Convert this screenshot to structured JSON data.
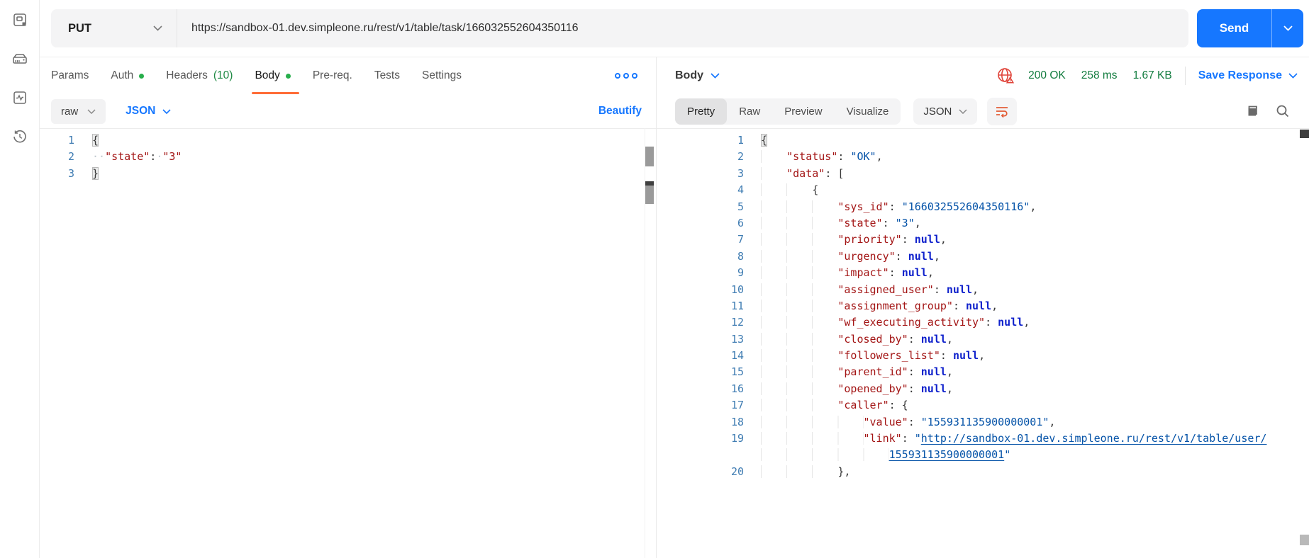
{
  "colors": {
    "accent_blue": "#1677ff",
    "tab_underline_orange": "#ff6c37",
    "status_green": "#127c3f",
    "dot_green": "#27ae4b",
    "json_key_maroon": "#a31515",
    "json_value_blue": "#0553a8",
    "json_null_blue": "#1022cc",
    "error_red": "#e0443a"
  },
  "sidebar": {
    "icons": [
      "collections",
      "server",
      "activity",
      "history"
    ]
  },
  "request_bar": {
    "method": "PUT",
    "url": "https://sandbox-01.dev.simpleone.ru/rest/v1/table/task/166032552604350116",
    "send_label": "Send"
  },
  "request_tabs": {
    "items": [
      {
        "label": "Params"
      },
      {
        "label": "Auth",
        "dot": true
      },
      {
        "label": "Headers",
        "count": "(10)"
      },
      {
        "label": "Body",
        "dot": true,
        "active": true
      },
      {
        "label": "Pre-req."
      },
      {
        "label": "Tests"
      },
      {
        "label": "Settings"
      }
    ]
  },
  "request_toolbar": {
    "body_type": "raw",
    "language": "JSON",
    "beautify_label": "Beautify"
  },
  "request_editor": {
    "lines": [
      {
        "n": "1",
        "tokens": [
          {
            "t": "brkt",
            "v": "{"
          }
        ]
      },
      {
        "n": "2",
        "tokens": [
          {
            "t": "wsd",
            "v": "··"
          },
          {
            "t": "str",
            "v": "\"state\""
          },
          {
            "t": "punc",
            "v": ":"
          },
          {
            "t": "wsd",
            "v": "·"
          },
          {
            "t": "str",
            "v": "\"3\""
          }
        ]
      },
      {
        "n": "3",
        "tokens": [
          {
            "t": "brkt",
            "v": "}"
          }
        ]
      }
    ]
  },
  "response_header": {
    "title": "Body",
    "status": "200 OK",
    "time": "258 ms",
    "size": "1.67 KB",
    "save_label": "Save Response"
  },
  "response_toolbar": {
    "view_tabs": [
      "Pretty",
      "Raw",
      "Preview",
      "Visualize"
    ],
    "active_view": "Pretty",
    "language": "JSON"
  },
  "response_editor": {
    "lines": [
      {
        "n": "1",
        "tokens": [
          {
            "t": "brkt",
            "v": "{"
          }
        ]
      },
      {
        "n": "2",
        "tokens": [
          {
            "t": "ws",
            "v": "    "
          },
          {
            "t": "key",
            "v": "\"status\""
          },
          {
            "t": "punc",
            "v": ": "
          },
          {
            "t": "val",
            "v": "\"OK\""
          },
          {
            "t": "punc",
            "v": ","
          }
        ]
      },
      {
        "n": "3",
        "tokens": [
          {
            "t": "ws",
            "v": "    "
          },
          {
            "t": "key",
            "v": "\"data\""
          },
          {
            "t": "punc",
            "v": ": ["
          }
        ]
      },
      {
        "n": "4",
        "tokens": [
          {
            "t": "ws",
            "v": "        "
          },
          {
            "t": "punc",
            "v": "{"
          }
        ]
      },
      {
        "n": "5",
        "tokens": [
          {
            "t": "ws",
            "v": "            "
          },
          {
            "t": "key",
            "v": "\"sys_id\""
          },
          {
            "t": "punc",
            "v": ": "
          },
          {
            "t": "val",
            "v": "\"166032552604350116\""
          },
          {
            "t": "punc",
            "v": ","
          }
        ]
      },
      {
        "n": "6",
        "tokens": [
          {
            "t": "ws",
            "v": "            "
          },
          {
            "t": "key",
            "v": "\"state\""
          },
          {
            "t": "punc",
            "v": ": "
          },
          {
            "t": "val",
            "v": "\"3\""
          },
          {
            "t": "punc",
            "v": ","
          }
        ]
      },
      {
        "n": "7",
        "tokens": [
          {
            "t": "ws",
            "v": "            "
          },
          {
            "t": "key",
            "v": "\"priority\""
          },
          {
            "t": "punc",
            "v": ": "
          },
          {
            "t": "kw",
            "v": "null"
          },
          {
            "t": "punc",
            "v": ","
          }
        ]
      },
      {
        "n": "8",
        "tokens": [
          {
            "t": "ws",
            "v": "            "
          },
          {
            "t": "key",
            "v": "\"urgency\""
          },
          {
            "t": "punc",
            "v": ": "
          },
          {
            "t": "kw",
            "v": "null"
          },
          {
            "t": "punc",
            "v": ","
          }
        ]
      },
      {
        "n": "9",
        "tokens": [
          {
            "t": "ws",
            "v": "            "
          },
          {
            "t": "key",
            "v": "\"impact\""
          },
          {
            "t": "punc",
            "v": ": "
          },
          {
            "t": "kw",
            "v": "null"
          },
          {
            "t": "punc",
            "v": ","
          }
        ]
      },
      {
        "n": "10",
        "tokens": [
          {
            "t": "ws",
            "v": "            "
          },
          {
            "t": "key",
            "v": "\"assigned_user\""
          },
          {
            "t": "punc",
            "v": ": "
          },
          {
            "t": "kw",
            "v": "null"
          },
          {
            "t": "punc",
            "v": ","
          }
        ]
      },
      {
        "n": "11",
        "tokens": [
          {
            "t": "ws",
            "v": "            "
          },
          {
            "t": "key",
            "v": "\"assignment_group\""
          },
          {
            "t": "punc",
            "v": ": "
          },
          {
            "t": "kw",
            "v": "null"
          },
          {
            "t": "punc",
            "v": ","
          }
        ]
      },
      {
        "n": "12",
        "tokens": [
          {
            "t": "ws",
            "v": "            "
          },
          {
            "t": "key",
            "v": "\"wf_executing_activity\""
          },
          {
            "t": "punc",
            "v": ": "
          },
          {
            "t": "kw",
            "v": "null"
          },
          {
            "t": "punc",
            "v": ","
          }
        ]
      },
      {
        "n": "13",
        "tokens": [
          {
            "t": "ws",
            "v": "            "
          },
          {
            "t": "key",
            "v": "\"closed_by\""
          },
          {
            "t": "punc",
            "v": ": "
          },
          {
            "t": "kw",
            "v": "null"
          },
          {
            "t": "punc",
            "v": ","
          }
        ]
      },
      {
        "n": "14",
        "tokens": [
          {
            "t": "ws",
            "v": "            "
          },
          {
            "t": "key",
            "v": "\"followers_list\""
          },
          {
            "t": "punc",
            "v": ": "
          },
          {
            "t": "kw",
            "v": "null"
          },
          {
            "t": "punc",
            "v": ","
          }
        ]
      },
      {
        "n": "15",
        "tokens": [
          {
            "t": "ws",
            "v": "            "
          },
          {
            "t": "key",
            "v": "\"parent_id\""
          },
          {
            "t": "punc",
            "v": ": "
          },
          {
            "t": "kw",
            "v": "null"
          },
          {
            "t": "punc",
            "v": ","
          }
        ]
      },
      {
        "n": "16",
        "tokens": [
          {
            "t": "ws",
            "v": "            "
          },
          {
            "t": "key",
            "v": "\"opened_by\""
          },
          {
            "t": "punc",
            "v": ": "
          },
          {
            "t": "kw",
            "v": "null"
          },
          {
            "t": "punc",
            "v": ","
          }
        ]
      },
      {
        "n": "17",
        "tokens": [
          {
            "t": "ws",
            "v": "            "
          },
          {
            "t": "key",
            "v": "\"caller\""
          },
          {
            "t": "punc",
            "v": ": {"
          }
        ]
      },
      {
        "n": "18",
        "tokens": [
          {
            "t": "ws",
            "v": "                "
          },
          {
            "t": "key",
            "v": "\"value\""
          },
          {
            "t": "punc",
            "v": ": "
          },
          {
            "t": "val",
            "v": "\"155931135900000001\""
          },
          {
            "t": "punc",
            "v": ","
          }
        ]
      },
      {
        "n": "19",
        "tokens": [
          {
            "t": "ws",
            "v": "                "
          },
          {
            "t": "key",
            "v": "\"link\""
          },
          {
            "t": "punc",
            "v": ": "
          },
          {
            "t": "val",
            "v": "\""
          },
          {
            "t": "link",
            "v": "http://sandbox-01.dev.simpleone.ru/rest/v1/table/user/"
          }
        ]
      },
      {
        "n": "",
        "tokens": [
          {
            "t": "ws",
            "v": "                    "
          },
          {
            "t": "link",
            "v": "155931135900000001"
          },
          {
            "t": "val",
            "v": "\""
          }
        ]
      },
      {
        "n": "20",
        "tokens": [
          {
            "t": "ws",
            "v": "            "
          },
          {
            "t": "punc",
            "v": "},"
          }
        ]
      }
    ]
  }
}
